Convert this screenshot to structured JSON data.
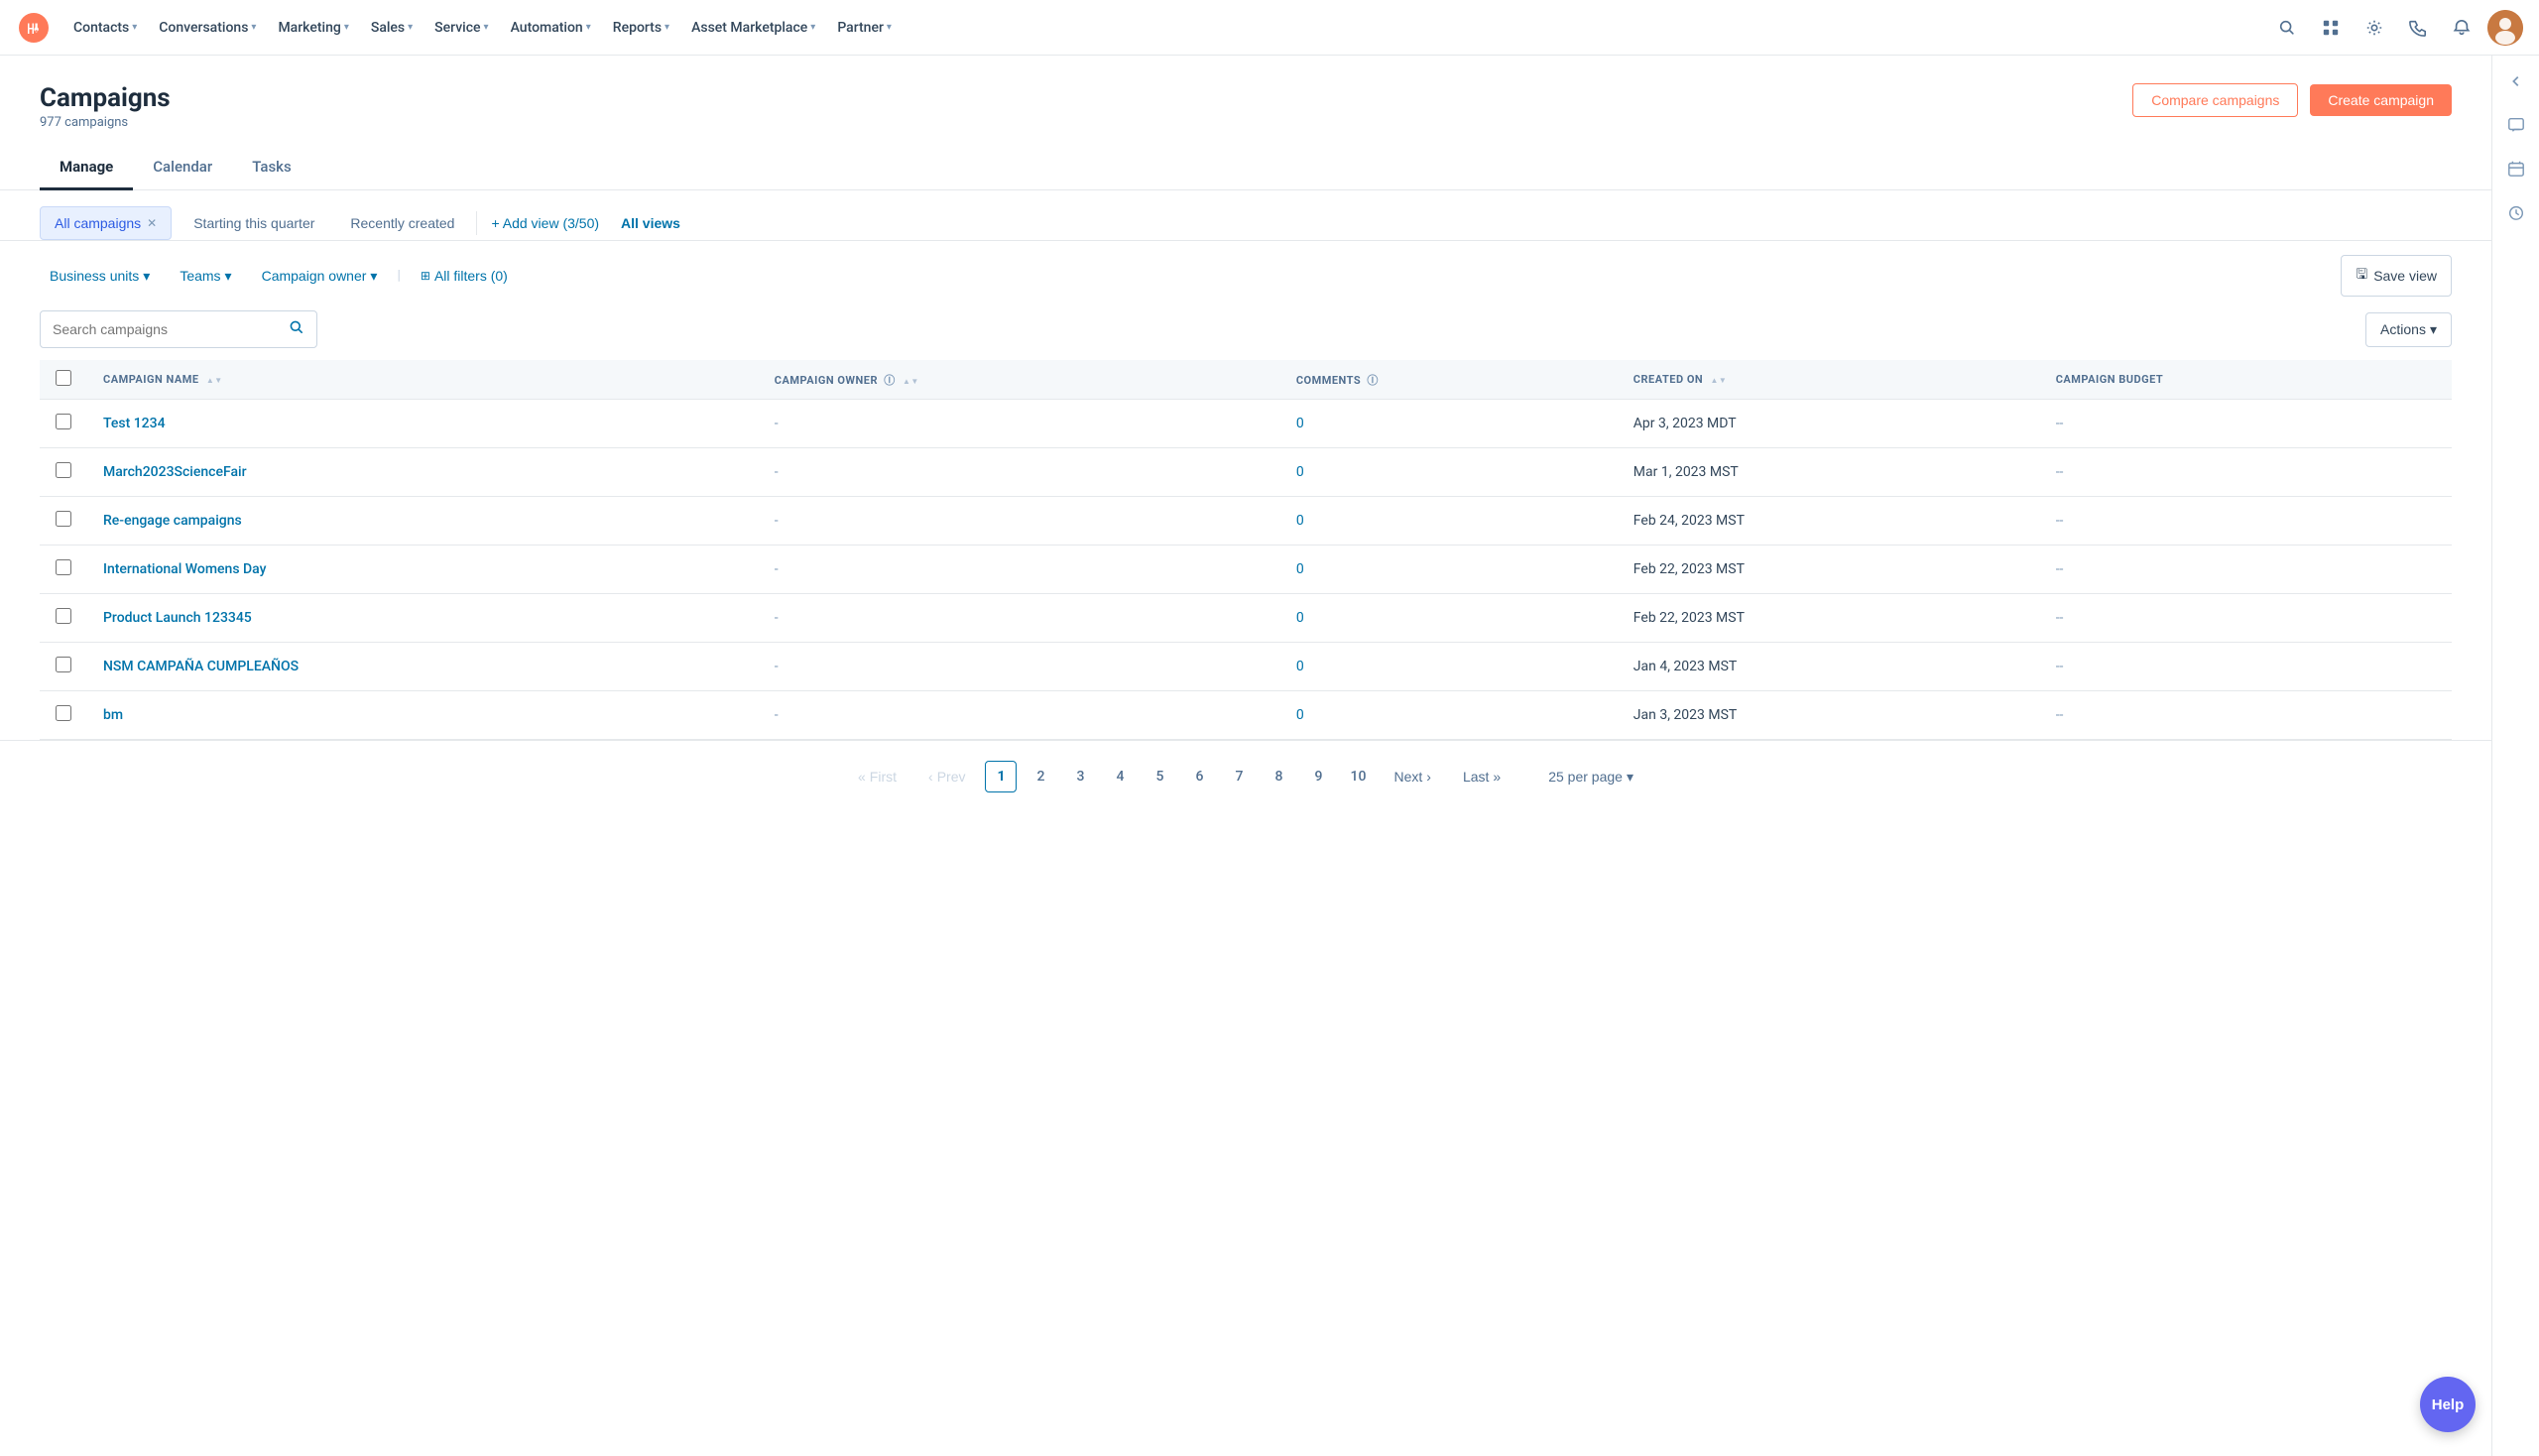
{
  "app": {
    "logo_label": "HubSpot",
    "nav_items": [
      {
        "label": "Contacts",
        "id": "contacts"
      },
      {
        "label": "Conversations",
        "id": "conversations"
      },
      {
        "label": "Marketing",
        "id": "marketing"
      },
      {
        "label": "Sales",
        "id": "sales"
      },
      {
        "label": "Service",
        "id": "service"
      },
      {
        "label": "Automation",
        "id": "automation"
      },
      {
        "label": "Reports",
        "id": "reports"
      },
      {
        "label": "Asset Marketplace",
        "id": "asset-marketplace"
      },
      {
        "label": "Partner",
        "id": "partner"
      }
    ]
  },
  "page": {
    "title": "Campaigns",
    "subtitle": "977 campaigns",
    "compare_btn": "Compare campaigns",
    "create_btn": "Create campaign"
  },
  "tabs": [
    {
      "label": "Manage",
      "id": "manage",
      "active": true
    },
    {
      "label": "Calendar",
      "id": "calendar",
      "active": false
    },
    {
      "label": "Tasks",
      "id": "tasks",
      "active": false
    }
  ],
  "views": [
    {
      "label": "All campaigns",
      "id": "all-campaigns",
      "active": true,
      "closable": true
    },
    {
      "label": "Starting this quarter",
      "id": "starting-this-quarter",
      "active": false,
      "closable": false
    },
    {
      "label": "Recently created",
      "id": "recently-created",
      "active": false,
      "closable": false
    }
  ],
  "add_view": {
    "label": "+ Add view (3/50)",
    "all_views_label": "All views"
  },
  "filters": {
    "business_units": "Business units",
    "teams": "Teams",
    "campaign_owner": "Campaign owner",
    "all_filters": "All filters (0)",
    "save_view": "Save view"
  },
  "search": {
    "placeholder": "Search campaigns"
  },
  "actions_btn": "Actions",
  "table": {
    "columns": [
      {
        "label": "CAMPAIGN NAME",
        "id": "campaign-name",
        "sortable": true
      },
      {
        "label": "CAMPAIGN OWNER",
        "id": "campaign-owner",
        "sortable": true,
        "info": true
      },
      {
        "label": "COMMENTS",
        "id": "comments",
        "sortable": false,
        "info": true
      },
      {
        "label": "CREATED ON",
        "id": "created-on",
        "sortable": true
      },
      {
        "label": "CAMPAIGN BUDGET",
        "id": "campaign-budget",
        "sortable": false
      }
    ],
    "rows": [
      {
        "name": "Test 1234",
        "owner": "-",
        "comments": "0",
        "created_on": "Apr 3, 2023 MDT",
        "budget": "--"
      },
      {
        "name": "March2023ScienceFair",
        "owner": "-",
        "comments": "0",
        "created_on": "Mar 1, 2023 MST",
        "budget": "--"
      },
      {
        "name": "Re-engage campaigns",
        "owner": "-",
        "comments": "0",
        "created_on": "Feb 24, 2023 MST",
        "budget": "--"
      },
      {
        "name": "International Womens Day",
        "owner": "-",
        "comments": "0",
        "created_on": "Feb 22, 2023 MST",
        "budget": "--"
      },
      {
        "name": "Product Launch 123345",
        "owner": "-",
        "comments": "0",
        "created_on": "Feb 22, 2023 MST",
        "budget": "--"
      },
      {
        "name": "NSM CAMPAÑA CUMPLEAÑOS",
        "owner": "-",
        "comments": "0",
        "created_on": "Jan 4, 2023 MST",
        "budget": "--"
      },
      {
        "name": "bm",
        "owner": "-",
        "comments": "0",
        "created_on": "Jan 3, 2023 MST",
        "budget": "--"
      }
    ]
  },
  "pagination": {
    "first_label": "First",
    "prev_label": "Prev",
    "next_label": "Next",
    "last_label": "Last",
    "current_page": 1,
    "pages": [
      1,
      2,
      3,
      4,
      5,
      6,
      7,
      8,
      9,
      10
    ],
    "per_page_label": "25 per page"
  },
  "help_btn": "Help",
  "right_sidebar": {
    "icons": [
      {
        "name": "chat-icon",
        "symbol": "💬"
      },
      {
        "name": "calendar-icon",
        "symbol": "📅"
      },
      {
        "name": "clock-icon",
        "symbol": "🕐"
      }
    ]
  }
}
